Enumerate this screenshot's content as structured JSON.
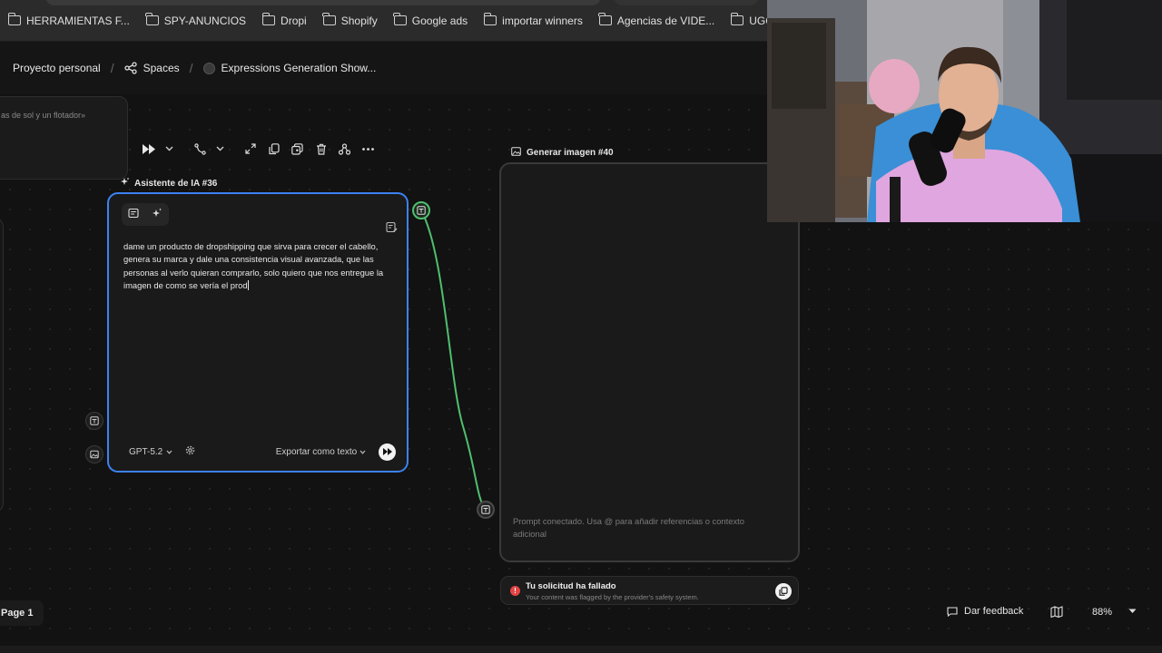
{
  "bookmarks": [
    {
      "label": "HERRAMIENTAS F...",
      "icon": "folder-icon"
    },
    {
      "label": "SPY-ANUNCIOS",
      "icon": "folder-icon"
    },
    {
      "label": "Dropi",
      "icon": "folder-icon"
    },
    {
      "label": "Shopify",
      "icon": "folder-icon"
    },
    {
      "label": "Google ads",
      "icon": "folder-icon"
    },
    {
      "label": "importar winners",
      "icon": "folder-icon"
    },
    {
      "label": "Agencias de VIDE...",
      "icon": "folder-icon"
    },
    {
      "label": "UGC AI",
      "icon": "folder-icon"
    },
    {
      "label": "",
      "icon": "doc-icon"
    }
  ],
  "breadcrumb": {
    "project": "Proyecto personal",
    "spaces": "Spaces",
    "current": "Expressions Generation Show..."
  },
  "left_card": {
    "text": "as de sol y un flotador»"
  },
  "ai_node": {
    "title": "Asistente de IA #36",
    "prompt": "dame un producto de dropshipping que sirva para crecer el cabello, genera su marca y dale una consistencia visual avanzada, que las personas al verlo quieran comprarlo, solo quiero que nos entregue la imagen de como se vería el prod",
    "model": "GPT-5.2",
    "export_label": "Exportar como texto"
  },
  "image_node": {
    "title": "Generar imagen #40",
    "prompt_placeholder": "Prompt conectado. Usa @ para añadir referencias o contexto adicional"
  },
  "error": {
    "title": "Tu solicitud ha fallado",
    "message": "Your content was flagged by the provider's safety system."
  },
  "bottom": {
    "page_tab": "Page 1",
    "feedback": "Dar feedback",
    "zoom": "88%"
  },
  "colors": {
    "selection_border": "#3d82f2",
    "connection": "#4fbf6d",
    "error": "#e14545"
  }
}
